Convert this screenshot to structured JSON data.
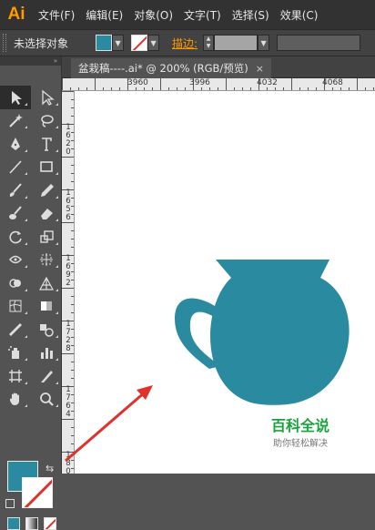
{
  "app": {
    "logo": "Ai"
  },
  "menu": {
    "items": [
      "文件(F)",
      "编辑(E)",
      "对象(O)",
      "文字(T)",
      "选择(S)",
      "效果(C)"
    ]
  },
  "control_bar": {
    "selection_status": "未选择对象",
    "stroke_label": "描边:",
    "fill_color": "#2a8aa0",
    "stroke_color": "none"
  },
  "document": {
    "tab_title": "盆栽稿----.ai* @ 200% (RGB/预览)",
    "close_symbol": "×"
  },
  "ruler": {
    "top_labels": [
      "3960",
      "3996",
      "4032",
      "4068"
    ],
    "left_labels": [
      "1620",
      "1656",
      "1692",
      "1728",
      "1764",
      "180"
    ]
  },
  "tools": [
    {
      "name": "selection-tool-icon",
      "active": true
    },
    {
      "name": "direct-selection-tool-icon"
    },
    {
      "name": "magic-wand-tool-icon"
    },
    {
      "name": "lasso-tool-icon"
    },
    {
      "name": "pen-tool-icon"
    },
    {
      "name": "type-tool-icon"
    },
    {
      "name": "line-tool-icon"
    },
    {
      "name": "rectangle-tool-icon"
    },
    {
      "name": "paintbrush-tool-icon"
    },
    {
      "name": "pencil-tool-icon"
    },
    {
      "name": "blob-brush-tool-icon"
    },
    {
      "name": "eraser-tool-icon"
    },
    {
      "name": "rotate-tool-icon"
    },
    {
      "name": "scale-tool-icon"
    },
    {
      "name": "width-tool-icon"
    },
    {
      "name": "free-transform-tool-icon"
    },
    {
      "name": "shape-builder-tool-icon"
    },
    {
      "name": "perspective-grid-tool-icon"
    },
    {
      "name": "mesh-tool-icon"
    },
    {
      "name": "gradient-tool-icon"
    },
    {
      "name": "eyedropper-tool-icon"
    },
    {
      "name": "blend-tool-icon"
    },
    {
      "name": "symbol-sprayer-tool-icon"
    },
    {
      "name": "column-graph-tool-icon"
    },
    {
      "name": "artboard-tool-icon"
    },
    {
      "name": "slice-tool-icon"
    },
    {
      "name": "hand-tool-icon"
    },
    {
      "name": "zoom-tool-icon"
    }
  ],
  "artwork": {
    "shape": "pot-with-handle",
    "color": "#2a8aa0"
  },
  "annotation": {
    "color": "#e0312d"
  },
  "watermark": {
    "title": "百科全说",
    "subtitle": "助你轻松解决"
  }
}
